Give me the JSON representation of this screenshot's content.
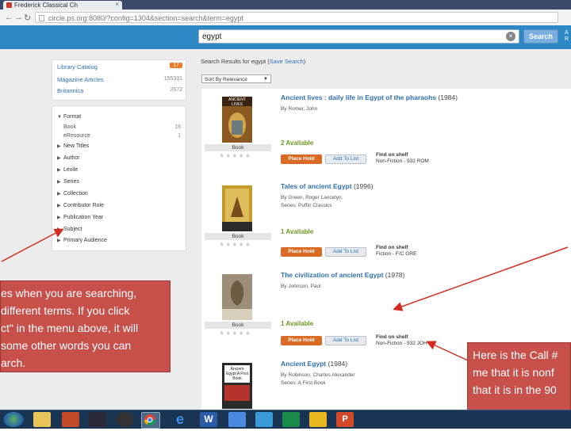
{
  "browser": {
    "tab_title": "Frederick Classical Ch",
    "url": "circle.ps.org:8080/?config=1304&section=search&term=egypt"
  },
  "search": {
    "query": "egypt",
    "button_label": "Search",
    "header_links": [
      "A",
      "R"
    ]
  },
  "sources": [
    {
      "label": "Library Catalog",
      "count": "17"
    },
    {
      "label": "Magazine Articles",
      "count": "155331"
    },
    {
      "label": "Britannica",
      "count": "2672"
    }
  ],
  "facets": {
    "format_label": "Format",
    "format_items": [
      {
        "label": "Book",
        "count": "16"
      },
      {
        "label": "eResource",
        "count": "1"
      }
    ],
    "items": [
      "New Titles",
      "Author",
      "Lexile",
      "Series",
      "Collection",
      "Contributor Role",
      "Publication Year",
      "Subject",
      "Primary Audience"
    ]
  },
  "results_header": {
    "prefix": "Search Results for egypt (",
    "link": "Save Search",
    "suffix": ")",
    "sort": "Sort By Relevance"
  },
  "results": [
    {
      "title": "Ancient lives : daily life in Egypt of the pharaohs",
      "year": "(1984)",
      "author": "By Romer, John",
      "series": "",
      "format": "Book",
      "availability": "2 Available",
      "hold": "Place Hold",
      "add": "Add To List",
      "shelf_label": "Find on shelf",
      "shelf_value": "Non-Fiction - 932 ROM",
      "cover_color": "#8a5a22"
    },
    {
      "title": "Tales of ancient Egypt",
      "year": "(1996)",
      "author": "By Green, Roger Lancelyn.",
      "series": "Series: Puffin Classics",
      "format": "Book",
      "availability": "1 Available",
      "hold": "Place Hold",
      "add": "Add To List",
      "shelf_label": "Find on shelf",
      "shelf_value": "Fiction - F/C GRE",
      "cover_color": "#c79a2e"
    },
    {
      "title": "The civilization of ancient Egypt",
      "year": "(1978)",
      "author": "By Johnson, Paul",
      "series": "",
      "format": "Book",
      "availability": "1 Available",
      "hold": "Place Hold",
      "add": "Add To List",
      "shelf_label": "Find on shelf",
      "shelf_value": "Non-Fiction - 932 JOH",
      "cover_color": "#9c8e78"
    },
    {
      "title": "Ancient Egypt",
      "year": "(1984)",
      "author": "By Robinson, Charles Alexander",
      "series": "Series: A First Book",
      "format": "Book",
      "availability": "",
      "hold": "",
      "add": "",
      "shelf_label": "",
      "shelf_value": "",
      "cover_color": "#6a5a3a"
    }
  ],
  "callouts": {
    "left": [
      "es when you are searching,",
      " different terms. If you click",
      "ct\" in the menu above, it will",
      " some other words you can",
      "arch."
    ],
    "right": [
      "Here is the Call #",
      "me that it is nonf",
      "that it is in the 90"
    ]
  },
  "cover_text": {
    "book1": "ANCIENT LIVES",
    "book4": "Ancient Egypt A First Book"
  },
  "colors": {
    "header_blue": "#2e88c6",
    "link_blue": "#2f6fb3",
    "available_green": "#6a9b1e",
    "hold_orange": "#d96b24",
    "callout_red": "#c7504a",
    "annotation_red": "#d62c20"
  }
}
